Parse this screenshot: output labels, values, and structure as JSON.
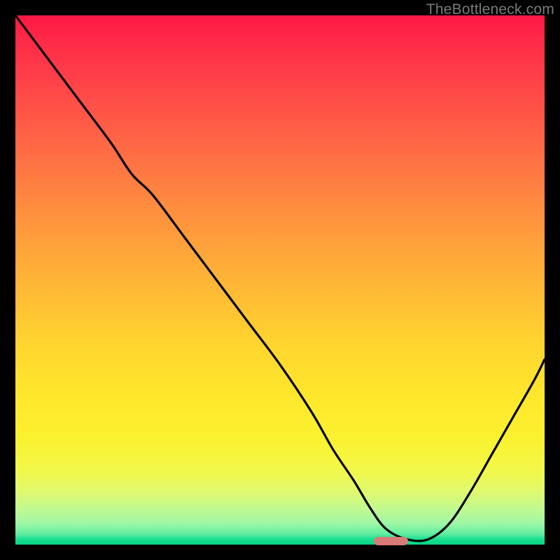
{
  "watermark": {
    "text": "TheBottleneck.com"
  },
  "chart_data": {
    "type": "line",
    "title": "",
    "xlabel": "",
    "ylabel": "",
    "xlim": [
      0,
      100
    ],
    "ylim": [
      0,
      100
    ],
    "grid": false,
    "series": [
      {
        "name": "bottleneck-curve",
        "x": [
          0,
          6,
          12,
          18,
          22,
          26,
          32,
          38,
          44,
          50,
          56,
          60,
          64,
          67,
          70,
          74,
          78,
          82,
          86,
          90,
          94,
          98,
          100
        ],
        "y": [
          100,
          92,
          84,
          76,
          70,
          66,
          58,
          50,
          42,
          34,
          25,
          18,
          12,
          7,
          3,
          1,
          1,
          4,
          10,
          17,
          24,
          31,
          35
        ]
      }
    ],
    "marker": {
      "x": 71,
      "y": 0.7,
      "width": 6.5,
      "height": 1.6,
      "color": "#d87a77"
    },
    "gradient_stops": [
      {
        "pos": 0,
        "color": "#ff1745"
      },
      {
        "pos": 50,
        "color": "#ffb037"
      },
      {
        "pos": 85,
        "color": "#f4f740"
      },
      {
        "pos": 100,
        "color": "#07d486"
      }
    ]
  }
}
